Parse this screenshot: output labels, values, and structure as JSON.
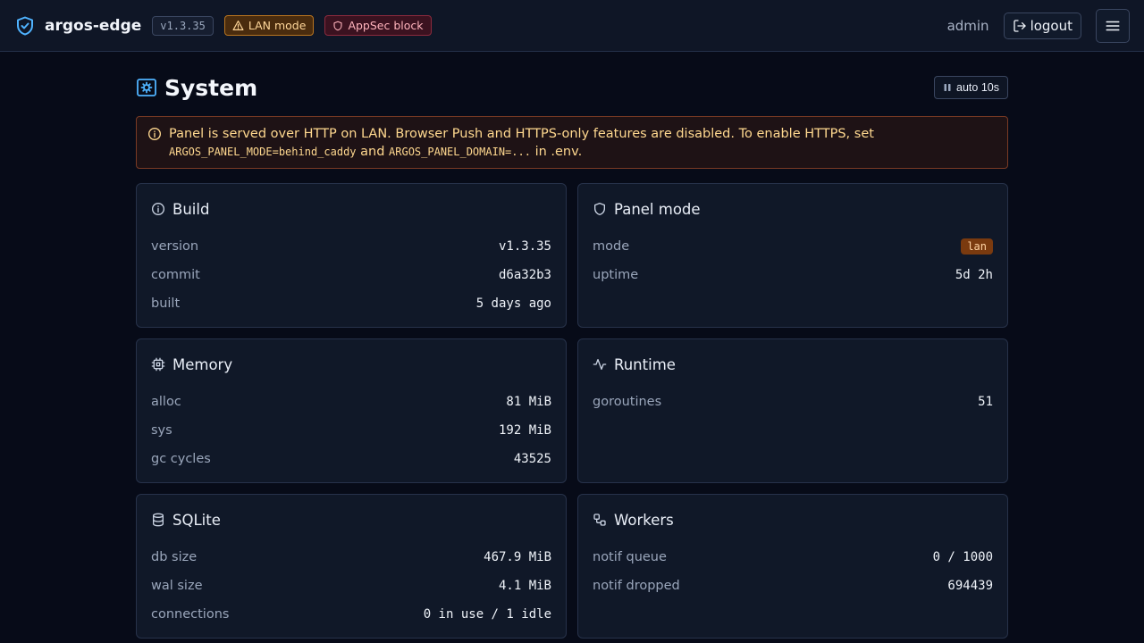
{
  "header": {
    "brand": "argos-edge",
    "version": "v1.3.35",
    "lan_badge": "LAN mode",
    "appsec_badge": "AppSec block",
    "user": "admin",
    "logout_label": "logout"
  },
  "page": {
    "title": "System",
    "auto_refresh": "auto 10s"
  },
  "alert": {
    "text1": "Panel is served over HTTP on LAN. Browser Push and HTTPS-only features are disabled. To enable HTTPS, set",
    "code1": "ARGOS_PANEL_MODE=behind_caddy",
    "and": "and",
    "code2": "ARGOS_PANEL_DOMAIN=...",
    "in": "in",
    "file": ".env."
  },
  "cards": {
    "build": {
      "title": "Build",
      "rows": [
        {
          "label": "version",
          "value": "v1.3.35"
        },
        {
          "label": "commit",
          "value": "d6a32b3"
        },
        {
          "label": "built",
          "value": "5 days ago"
        }
      ]
    },
    "panel_mode": {
      "title": "Panel mode",
      "rows": [
        {
          "label": "mode",
          "value": "lan"
        },
        {
          "label": "uptime",
          "value": "5d 2h"
        }
      ]
    },
    "memory": {
      "title": "Memory",
      "rows": [
        {
          "label": "alloc",
          "value": "81 MiB"
        },
        {
          "label": "sys",
          "value": "192 MiB"
        },
        {
          "label": "gc cycles",
          "value": "43525"
        }
      ]
    },
    "runtime": {
      "title": "Runtime",
      "rows": [
        {
          "label": "goroutines",
          "value": "51"
        }
      ]
    },
    "sqlite": {
      "title": "SQLite",
      "rows": [
        {
          "label": "db size",
          "value": "467.9 MiB"
        },
        {
          "label": "wal size",
          "value": "4.1 MiB"
        },
        {
          "label": "connections",
          "value": "0 in use / 1 idle"
        }
      ]
    },
    "workers": {
      "title": "Workers",
      "rows": [
        {
          "label": "notif queue",
          "value": "0 / 1000"
        },
        {
          "label": "notif dropped",
          "value": "694439"
        }
      ]
    }
  },
  "icons": {
    "brand": "shield-check-icon",
    "lan": "warning-triangle-icon",
    "appsec": "shield-icon",
    "logout": "logout-icon",
    "menu": "hamburger-menu-icon",
    "page": "settings-gear-icon",
    "auto": "pause-icon",
    "alert": "info-circle-icon",
    "build": "info-circle-icon",
    "panel_mode": "shield-icon",
    "memory": "cpu-chip-icon",
    "runtime": "activity-pulse-icon",
    "sqlite": "database-icon",
    "workers": "workflow-icon"
  },
  "colors": {
    "accent": "#4fb3ff",
    "warning": "#ffd88f",
    "danger": "#ffb3bc",
    "background": "#070b18"
  }
}
